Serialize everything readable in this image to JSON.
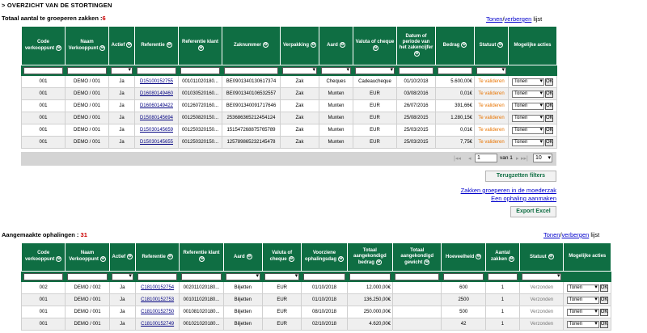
{
  "page_heading": "> OVERZICHT VAN DE STORTINGEN",
  "section1": {
    "title": "Totaal aantal te groeperen zakken :",
    "count": "6",
    "toggle": {
      "show": "Tonen",
      "sep": "/",
      "hide": "verbergen",
      "suffix": " lijst"
    },
    "headers": [
      "Code verkooppunt",
      "Naam Verkooppunt",
      "Actief",
      "Referentie",
      "Referentie klant",
      "Zaknummer",
      "Verpakking",
      "Aard",
      "Valuta of cheque",
      "Datum of periode van het zakencijfer",
      "Bedrag",
      "Statuut",
      "Mogelijke acties"
    ],
    "rows": [
      [
        "001",
        "DEMO / 001",
        "Ja",
        "D15100152755",
        "001011020180...",
        "BE0901340130617374",
        "Zak",
        "Cheques",
        "Cadeaucheque",
        "01/10/2018",
        "5.600,00€",
        "Te valideren",
        "Tonen"
      ],
      [
        "001",
        "DEMO / 001",
        "Ja",
        "D16080149460",
        "001030520160...",
        "BE0901340106532557",
        "Zak",
        "Munten",
        "EUR",
        "03/08/2016",
        "0,01€",
        "Te valideren",
        "Tonen"
      ],
      [
        "001",
        "DEMO / 001",
        "Ja",
        "D16060149422",
        "001260720160...",
        "BE0901340091717646",
        "Zak",
        "Munten",
        "EUR",
        "26/07/2016",
        "391,66€",
        "Te valideren",
        "Tonen"
      ],
      [
        "001",
        "DEMO / 001",
        "Ja",
        "D15080145694",
        "001250820150...",
        "253686365212454124",
        "Zak",
        "Munten",
        "EUR",
        "25/08/2015",
        "1.280,15€",
        "Te valideren",
        "Tonen"
      ],
      [
        "001",
        "DEMO / 001",
        "Ja",
        "D15030145659",
        "001250320150...",
        "151547268875765789",
        "Zak",
        "Munten",
        "EUR",
        "25/03/2015",
        "0,01€",
        "Te valideren",
        "Tonen"
      ],
      [
        "001",
        "DEMO / 001",
        "Ja",
        "D15030145655",
        "001250320150...",
        "125789865232145478",
        "Zak",
        "Munten",
        "EUR",
        "25/03/2015",
        "7,75€",
        "Te valideren",
        "Tonen"
      ]
    ],
    "pager": {
      "first": "|◂◂",
      "prev": "◂",
      "page": "1",
      "of_label": "van 1",
      "next": "▸",
      "last": "▸▸|",
      "page_size": "10"
    }
  },
  "actions": {
    "reset_filters": "Terugzetten filters",
    "group_bags": "Zakken groeperen in de moederzak",
    "create_pickup": "Een ophaling aanmaken",
    "export_excel": "Export Excel",
    "ok": "OK"
  },
  "section2": {
    "title": "Aangemaakte ophalingen : ",
    "count": "31",
    "toggle": {
      "show": "Tonen",
      "sep": "/",
      "hide": "verbergen",
      "suffix": " lijst"
    },
    "headers": [
      "Code verkooppunt",
      "Naam Verkooppunt",
      "Actief",
      "Referentie",
      "Referentie klant",
      "Aard",
      "Valuta of cheque",
      "Voorziene ophalingsdag",
      "Totaal aangekondigd bedrag",
      "Totaal aangekondigd gewicht",
      "Hoeveelheid",
      "Aantal zakken",
      "Statuut",
      "Mogelijke acties"
    ],
    "rows": [
      [
        "002",
        "DEMO / 002",
        "Ja",
        "C18100152754",
        "002011020180...",
        "Biljetten",
        "EUR",
        "01/10/2018",
        "12.000,00€",
        "",
        "600",
        "1",
        "Verzonden",
        "Tonen"
      ],
      [
        "001",
        "DEMO / 001",
        "Ja",
        "C18100152753",
        "001011020180...",
        "Biljetten",
        "EUR",
        "01/10/2018",
        "136.250,00€",
        "",
        "2500",
        "1",
        "Verzonden",
        "Tonen"
      ],
      [
        "001",
        "DEMO / 001",
        "Ja",
        "C18100152750",
        "001081020180...",
        "Biljetten",
        "EUR",
        "08/10/2018",
        "250.000,00€",
        "",
        "500",
        "1",
        "Verzonden",
        "Tonen"
      ],
      [
        "001",
        "DEMO / 001",
        "Ja",
        "C18100152749",
        "001021020180...",
        "Biljetten",
        "EUR",
        "02/10/2018",
        "4.620,00€",
        "",
        "42",
        "1",
        "Verzonden",
        "Tonen"
      ]
    ]
  },
  "colors": {
    "header_green": "#0f6e43",
    "status_orange": "#e87400",
    "count_red": "#cc0000",
    "link_blue": "#0000cc"
  }
}
